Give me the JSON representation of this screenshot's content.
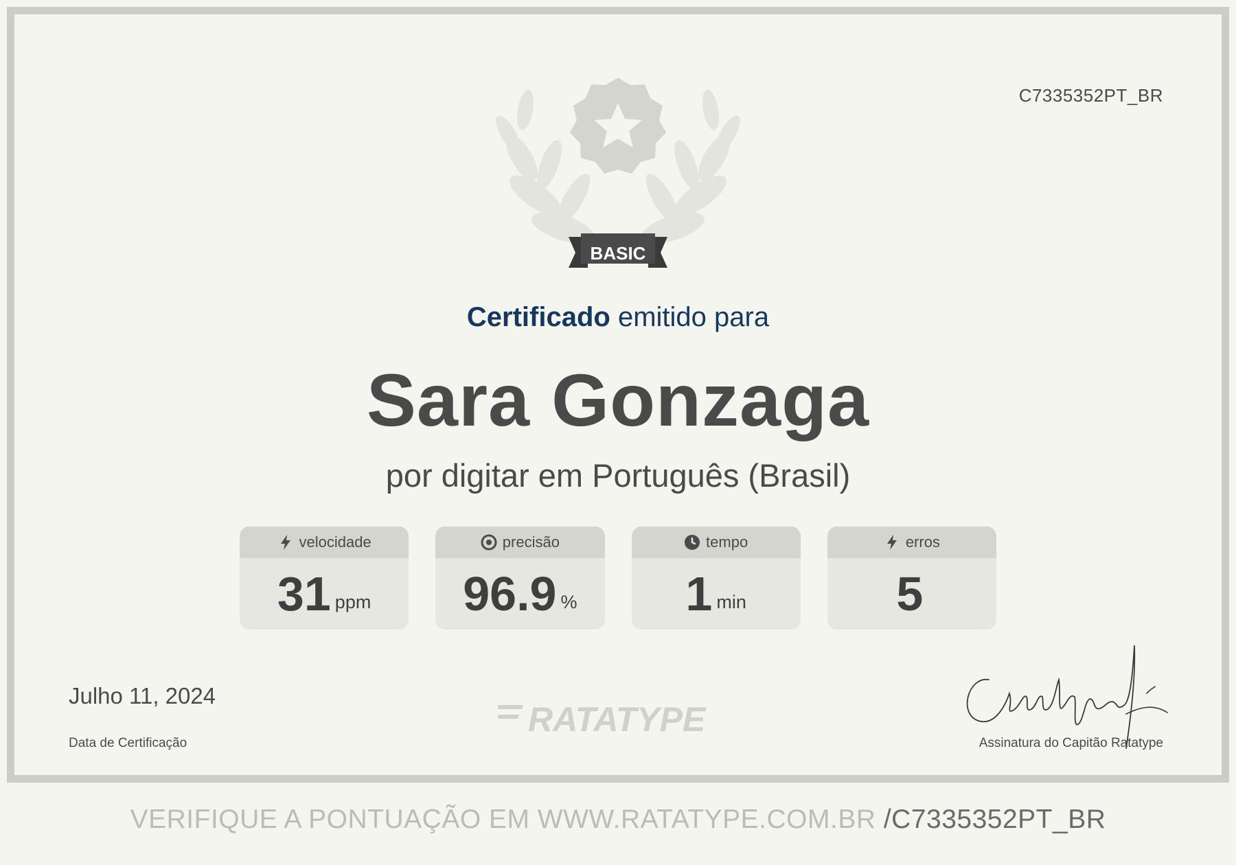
{
  "certificate": {
    "id": "C7335352PT_BR",
    "level_badge": "BASIC",
    "issued_strong": "Certificado",
    "issued_rest": " emitido para",
    "recipient": "Sara Gonzaga",
    "course": "por digitar em Português (Brasil)"
  },
  "stats": [
    {
      "label": "velocidade",
      "value": "31",
      "unit": "ppm",
      "icon": "lightning-icon"
    },
    {
      "label": "precisão",
      "value": "96.9",
      "unit": "%",
      "icon": "target-icon"
    },
    {
      "label": "tempo",
      "value": "1",
      "unit": "min",
      "icon": "clock-icon"
    },
    {
      "label": "erros",
      "value": "5",
      "unit": "",
      "icon": "lightning-icon"
    }
  ],
  "footer": {
    "date": "Julho 11, 2024",
    "date_caption": "Data de Certificação",
    "logo_text": "RATATYPE",
    "signature_caption": "Assinatura do Capitão Ratatype",
    "verify_text": "VERIFIQUE A PONTUAÇÃO EM WWW.RATATYPE.COM.BR ",
    "verify_code": "/C7335352PT_BR"
  },
  "colors": {
    "background": "#f4f5ef",
    "border": "#cccec5",
    "heading_blue": "#16375e",
    "badge_dark": "#4a4a4a",
    "emblem_gray": "#d9dad3"
  }
}
